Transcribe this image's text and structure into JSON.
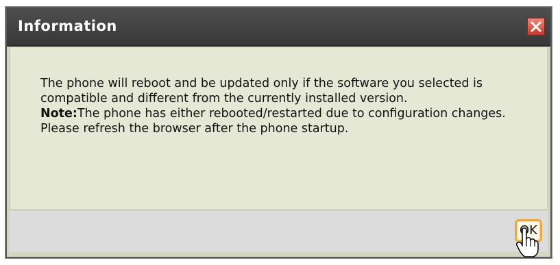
{
  "dialog": {
    "title": "Information",
    "message_line1": "The phone will reboot and be updated only if the software you selected is compatible and different from the currently installed version.",
    "note_label": "Note:",
    "note_text": "The phone has either rebooted/restarted due to configuration changes. Please refresh the browser after the phone startup.",
    "ok_label": "OK"
  },
  "icons": {
    "close": "close-icon",
    "cursor": "hand-pointer-icon"
  },
  "colors": {
    "titlebar": "#3f3f3f",
    "body": "#e6e8d6",
    "ok_border": "#e8a94a",
    "close": "#d9534f"
  }
}
